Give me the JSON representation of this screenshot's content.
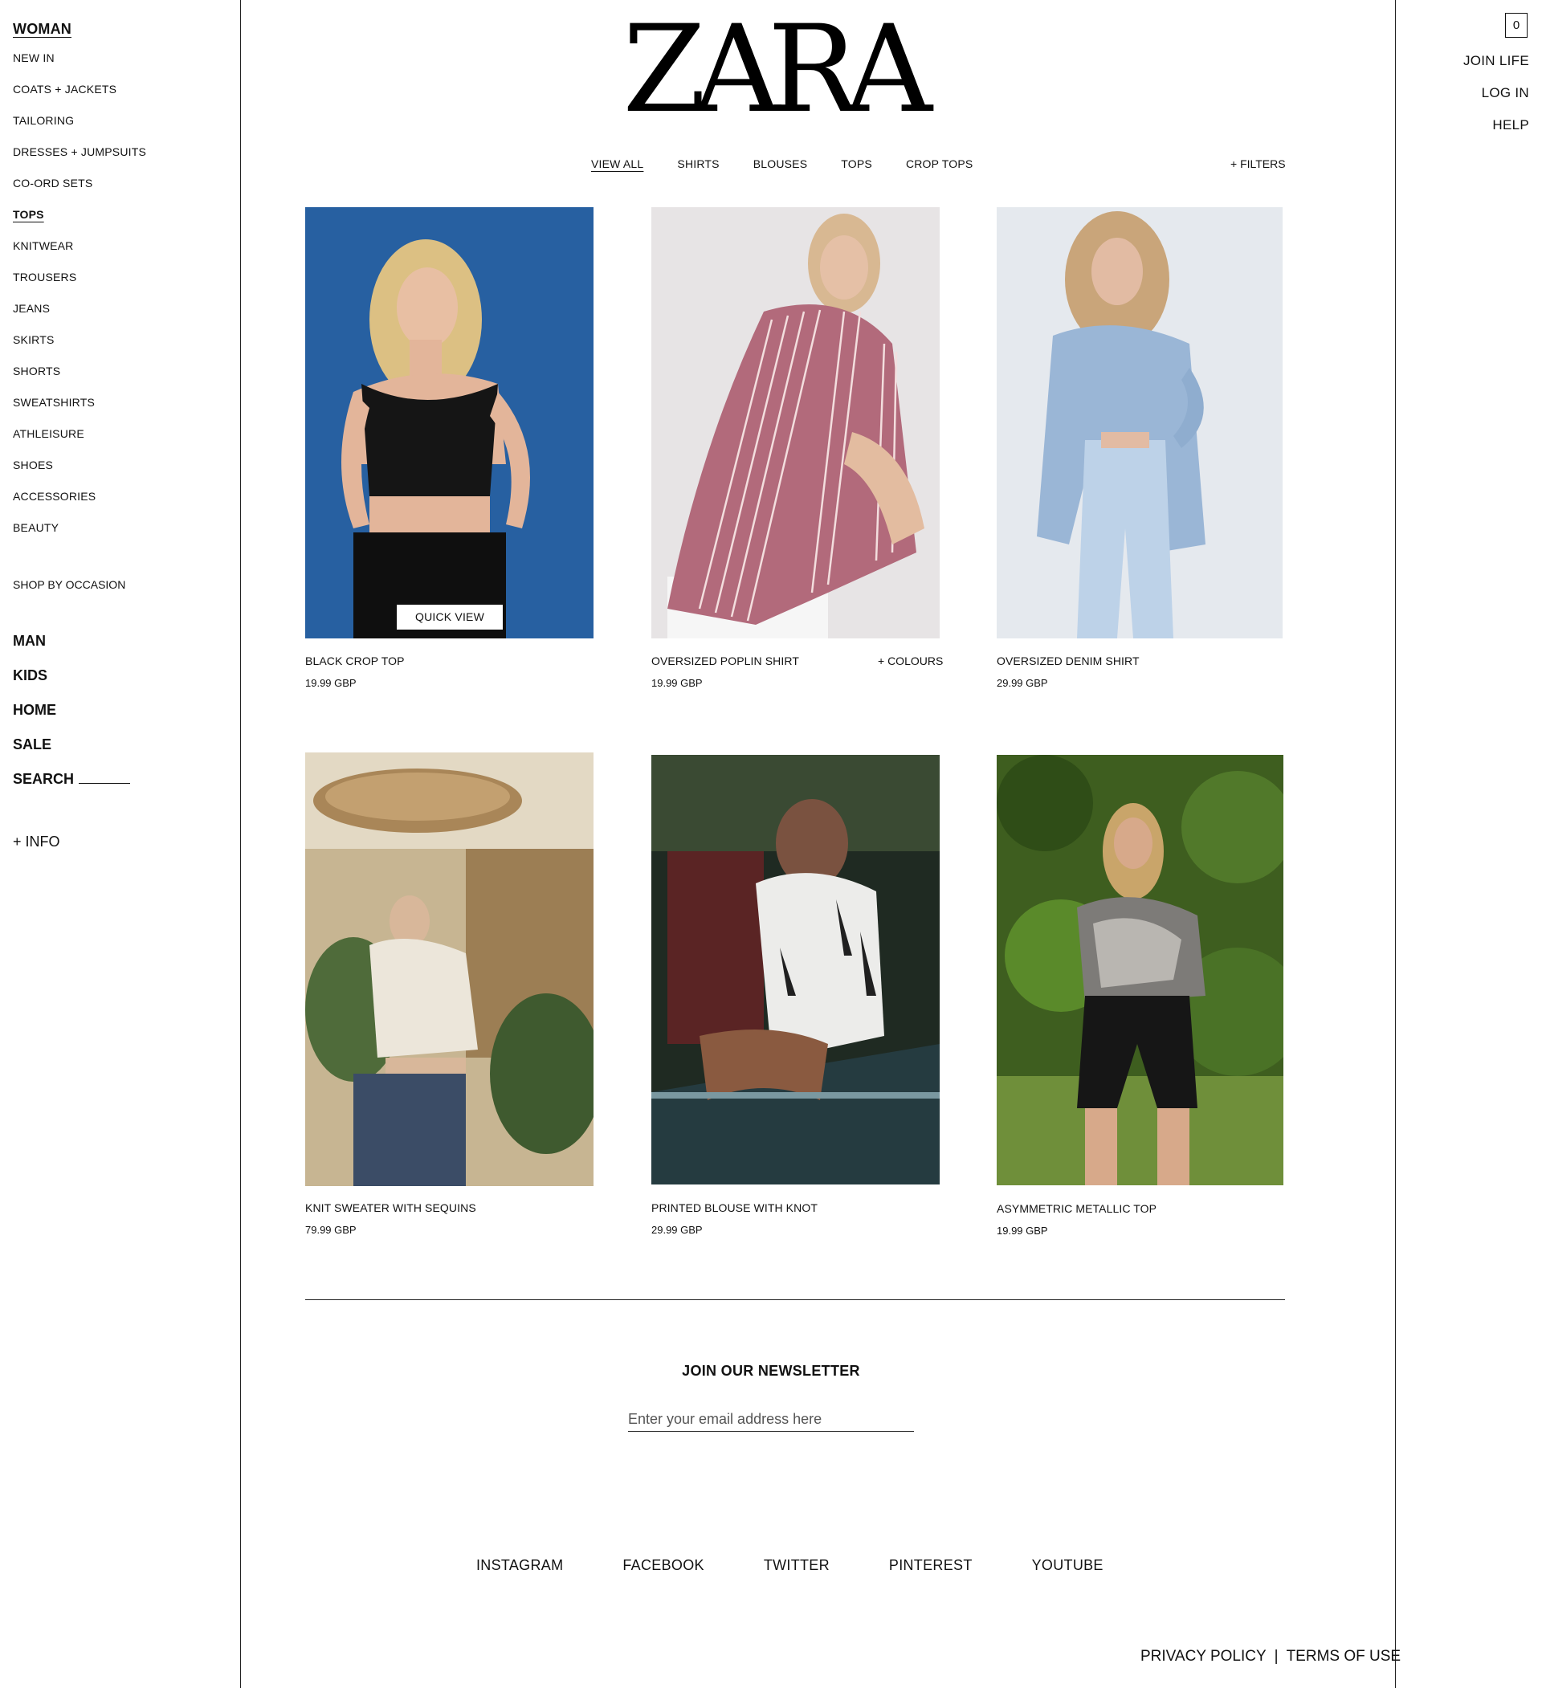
{
  "brand": {
    "logo_text": "ZARA"
  },
  "sidebar": {
    "heading": "WOMAN",
    "items": [
      {
        "label": "NEW IN",
        "active": false
      },
      {
        "label": "COATS + JACKETS",
        "active": false
      },
      {
        "label": "TAILORING",
        "active": false
      },
      {
        "label": "DRESSES + JUMPSUITS",
        "active": false
      },
      {
        "label": "CO-ORD SETS",
        "active": false
      },
      {
        "label": "TOPS",
        "active": true
      },
      {
        "label": "KNITWEAR",
        "active": false
      },
      {
        "label": "TROUSERS",
        "active": false
      },
      {
        "label": "JEANS",
        "active": false
      },
      {
        "label": "SKIRTS",
        "active": false
      },
      {
        "label": "SHORTS",
        "active": false
      },
      {
        "label": "SWEATSHIRTS",
        "active": false
      },
      {
        "label": "ATHLEISURE",
        "active": false
      },
      {
        "label": "SHOES",
        "active": false
      },
      {
        "label": "ACCESSORIES",
        "active": false
      },
      {
        "label": "BEAUTY",
        "active": false
      }
    ],
    "occasion": "SHOP BY OCCASION",
    "sections": [
      "MAN",
      "KIDS",
      "HOME",
      "SALE"
    ],
    "search_label": "SEARCH",
    "info": "+ INFO"
  },
  "header": {
    "cart_count": "0",
    "links": [
      "JOIN LIFE",
      "LOG IN",
      "HELP"
    ]
  },
  "subnav": {
    "items": [
      "VIEW ALL",
      "SHIRTS",
      "BLOUSES",
      "TOPS",
      "CROP TOPS"
    ],
    "active": "VIEW ALL",
    "filters": "+ FILTERS"
  },
  "products": [
    {
      "name": "BLACK CROP TOP",
      "price": "19.99 GBP",
      "quick_view": "QUICK VIEW"
    },
    {
      "name": "OVERSIZED POPLIN SHIRT",
      "price": "19.99 GBP",
      "extra": "+ COLOURS"
    },
    {
      "name": "OVERSIZED DENIM SHIRT",
      "price": "29.99 GBP"
    },
    {
      "name": "KNIT SWEATER WITH SEQUINS",
      "price": "79.99 GBP"
    },
    {
      "name": "PRINTED BLOUSE WITH KNOT",
      "price": "29.99 GBP"
    },
    {
      "name": "ASYMMETRIC METALLIC TOP",
      "price": "19.99 GBP"
    }
  ],
  "newsletter": {
    "title": "JOIN OUR NEWSLETTER",
    "placeholder": "Enter your email address here"
  },
  "social": [
    "INSTAGRAM",
    "FACEBOOK",
    "TWITTER",
    "PINTEREST",
    "YOUTUBE"
  ],
  "legal": [
    "PRIVACY POLICY",
    "TERMS OF USE"
  ],
  "legal_separator": "|",
  "icons": {
    "cart": "shopping-bag-icon"
  }
}
